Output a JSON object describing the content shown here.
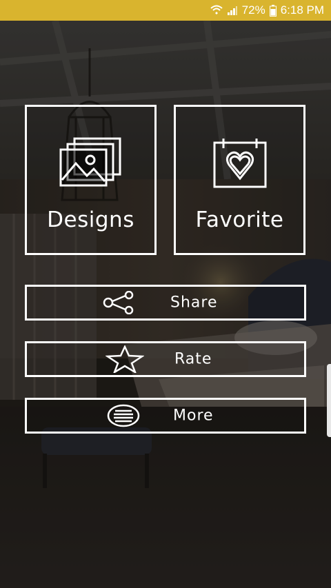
{
  "status_bar": {
    "battery": "72%",
    "time": "6:18 PM",
    "icons": [
      "wifi-icon",
      "cellular-signal-icon",
      "battery-icon"
    ],
    "color": "#d9b42e"
  },
  "menu": {
    "designs_label": "Designs",
    "favorite_label": "Favorite",
    "share_label": "Share",
    "rate_label": "Rate",
    "more_label": "More"
  },
  "icons": {
    "designs": "image-stack-icon",
    "favorite": "calendar-heart-icon",
    "share": "share-icon",
    "rate": "star-icon",
    "more": "list-circle-icon"
  }
}
